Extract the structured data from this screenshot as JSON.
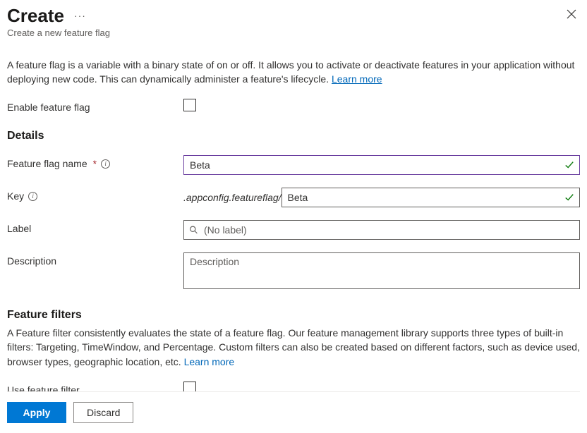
{
  "header": {
    "title": "Create",
    "subtitle": "Create a new feature flag"
  },
  "intro": {
    "text": "A feature flag is a variable with a binary state of on or off. It allows you to activate or deactivate features in your application without deploying new code. This can dynamically administer a feature's lifecycle. ",
    "learn_more": "Learn more"
  },
  "enable": {
    "label": "Enable feature flag"
  },
  "details": {
    "heading": "Details",
    "name_label": "Feature flag name",
    "name_value": "Beta",
    "key_label": "Key",
    "key_prefix": ".appconfig.featureflag/",
    "key_value": "Beta",
    "label_label": "Label",
    "label_placeholder": "(No label)",
    "description_label": "Description",
    "description_placeholder": "Description"
  },
  "filters": {
    "heading": "Feature filters",
    "text": "A Feature filter consistently evaluates the state of a feature flag. Our feature management library supports three types of built-in filters: Targeting, TimeWindow, and Percentage. Custom filters can also be created based on different factors, such as device used, browser types, geographic location, etc. ",
    "learn_more": "Learn more",
    "use_label": "Use feature filter"
  },
  "footer": {
    "apply": "Apply",
    "discard": "Discard"
  }
}
